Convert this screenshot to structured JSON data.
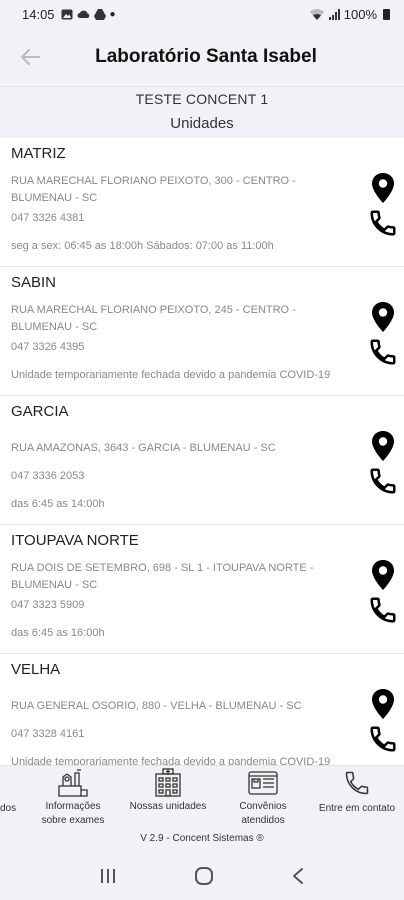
{
  "status_bar": {
    "time": "14:05",
    "battery": "100%"
  },
  "app_bar": {
    "title": "Laboratório Santa Isabel"
  },
  "subheader": {
    "client": "TESTE CONCENT 1",
    "section": "Unidades"
  },
  "units": [
    {
      "name": "MATRIZ",
      "address": "RUA MARECHAL FLORIANO PEIXOTO, 300 - CENTRO - BLUMENAU - SC",
      "phone": "047 3326 4381",
      "hours": "seg a sex: 06:45 as 18:00h Sábados: 07:00 as 11:00h"
    },
    {
      "name": "SABIN",
      "address": "RUA MARECHAL FLORIANO PEIXOTO, 245 - CENTRO - BLUMENAU - SC",
      "phone": "047 3326 4395",
      "hours": "Unidade temporariamente fechada devido a pandemia COVID-19"
    },
    {
      "name": "GARCIA",
      "address": "RUA AMAZONAS, 3643 - GARCIA - BLUMENAU - SC",
      "phone": "047 3336 2053",
      "hours": "das 6:45 as 14:00h"
    },
    {
      "name": "ITOUPAVA NORTE",
      "address": "RUA DOIS DE SETEMBRO, 698 - SL 1 - ITOUPAVA NORTE - BLUMENAU - SC",
      "phone": "047 3323 5909",
      "hours": "das 6:45 as 16:00h"
    },
    {
      "name": "VELHA",
      "address": "RUA GENERAL OSORIO, 880 - VELHA - BLUMENAU - SC",
      "phone": "047 3328 4161",
      "hours": "Unidade temporariamente fechada devido a pandemia COVID-19"
    }
  ],
  "bottom_nav": {
    "partial_label": "dos",
    "exams_label": "Informações sobre exames",
    "units_label": "Nossas unidades",
    "insurance_label": "Convênios atendidos",
    "contact_label": "Entre em contato",
    "version": "V 2.9 - Concent Sistemas ®"
  },
  "icons": {
    "back": "arrow-left-icon",
    "location": "location-pin-icon",
    "phone": "phone-icon",
    "exams": "exams-icon",
    "units": "building-icon",
    "insurance": "card-icon",
    "contact": "phone-icon"
  }
}
